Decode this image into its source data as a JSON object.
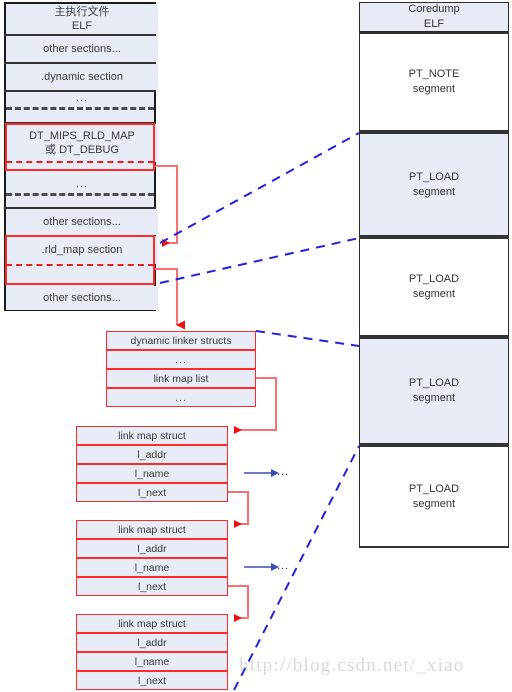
{
  "diagram": {
    "title": "ELF link map diagram",
    "colors": {
      "fill_blue": "#e7ecf6",
      "fill_white": "#ffffff",
      "frame_dark": "#1c1c1c",
      "accent_red": "#fb2b2b",
      "accent_blue": "#2222dd",
      "text": "#3a3a3a",
      "watermark": "#d9d9d9"
    },
    "ellipsis": "...",
    "watermark": "http://blog.csdn.net/_xiao"
  },
  "main_elf": {
    "header_line1": "主执行文件",
    "header_line2": "ELF",
    "rows": [
      {
        "label": "other sections..."
      },
      {
        "label": ".dynamic section"
      },
      {
        "label": "..."
      },
      {
        "label": "DT_MIPS_RLD_MAP\n或 DT_DEBUG"
      },
      {
        "label": "..."
      },
      {
        "label": "other sections..."
      },
      {
        "label": ".rld_map section"
      },
      {
        "label": "other sections..."
      }
    ],
    "dt_entry_line1": "DT_MIPS_RLD_MAP",
    "dt_entry_line2": "或 DT_DEBUG",
    "rld_map_label": ".rld_map section",
    "dynamic_label": ".dynamic section",
    "other_sections_label": "other sections..."
  },
  "coredump": {
    "header_line1": "Coredump",
    "header_line2": "ELF",
    "segments": [
      {
        "name": "PT_NOTE",
        "sub": "segment",
        "fill": "white"
      },
      {
        "name": "PT_LOAD",
        "sub": "segment",
        "fill": "blue"
      },
      {
        "name": "PT_LOAD",
        "sub": "segment",
        "fill": "white"
      },
      {
        "name": "PT_LOAD",
        "sub": "segment",
        "fill": "blue"
      },
      {
        "name": "PT_LOAD",
        "sub": "segment",
        "fill": "white"
      }
    ]
  },
  "linker_struct": {
    "rows": [
      {
        "label": "dynamic linker structs"
      },
      {
        "label": "..."
      },
      {
        "label": "link map list"
      },
      {
        "label": "..."
      }
    ],
    "title": "dynamic linker structs",
    "link_map_list": "link map list"
  },
  "link_maps": [
    {
      "title": "link map struct",
      "fields": [
        {
          "label": "l_addr"
        },
        {
          "label": "l_name"
        },
        {
          "label": "l_next"
        }
      ],
      "name_target": "..."
    },
    {
      "title": "link map struct",
      "fields": [
        {
          "label": "l_addr"
        },
        {
          "label": "l_name"
        },
        {
          "label": "l_next"
        }
      ],
      "name_target": "..."
    },
    {
      "title": "link map struct",
      "fields": [
        {
          "label": "l_addr"
        },
        {
          "label": "l_name"
        },
        {
          "label": "l_next"
        }
      ],
      "name_target": ""
    }
  ]
}
